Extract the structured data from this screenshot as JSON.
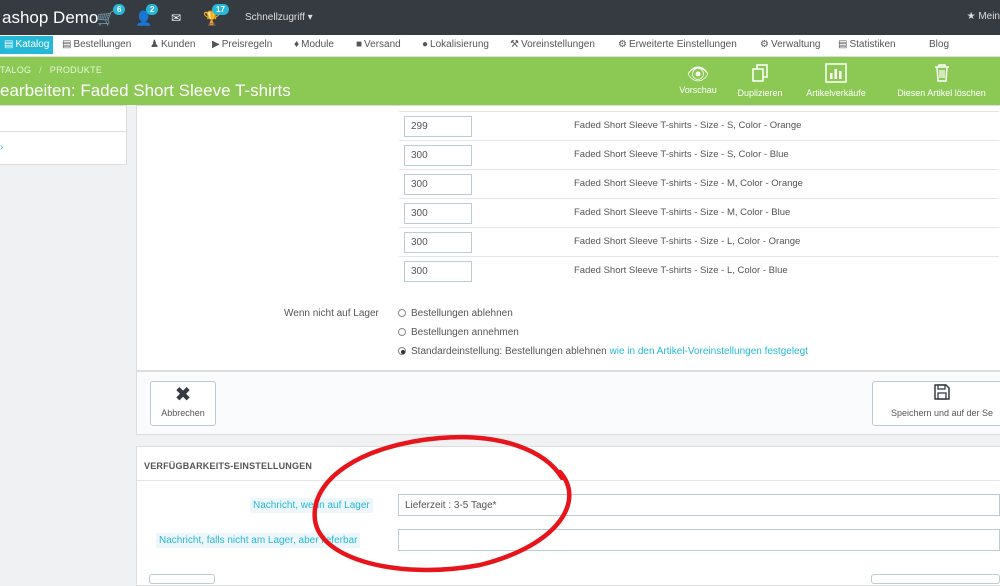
{
  "topbar": {
    "brand": "ashop Demo",
    "cart_badge": "6",
    "customers_badge": "2",
    "trophy_badge": "17",
    "quick_access": "Schnellzugriff ▾",
    "right_label": "★ Mein"
  },
  "nav": {
    "items": [
      {
        "label": "Katalog"
      },
      {
        "label": "Bestellungen"
      },
      {
        "label": "Kunden"
      },
      {
        "label": "Preisregeln"
      },
      {
        "label": "Module"
      },
      {
        "label": "Versand"
      },
      {
        "label": "Lokalisierung"
      },
      {
        "label": "Voreinstellungen"
      },
      {
        "label": "Erweiterte Einstellungen"
      },
      {
        "label": "Verwaltung"
      },
      {
        "label": "Statistiken"
      },
      {
        "label": "Blog"
      }
    ]
  },
  "header": {
    "breadcrumb_1": "TALOG",
    "breadcrumb_sep": "/",
    "breadcrumb_2": "PRODUKTE",
    "title": "earbeiten: Faded Short Sleeve T-shirts",
    "tools": [
      {
        "label": "Vorschau",
        "icon": "eye-icon"
      },
      {
        "label": "Duplizieren",
        "icon": "copy-icon"
      },
      {
        "label": "Artikelverkäufe",
        "icon": "bar-chart-icon"
      },
      {
        "label": "Diesen Artikel löschen",
        "icon": "trash-icon"
      }
    ]
  },
  "quantities": [
    {
      "qty": "299",
      "combination": "Faded Short Sleeve T-shirts - Size - S, Color - Orange"
    },
    {
      "qty": "300",
      "combination": "Faded Short Sleeve T-shirts - Size - S, Color - Blue"
    },
    {
      "qty": "300",
      "combination": "Faded Short Sleeve T-shirts - Size - M, Color - Orange"
    },
    {
      "qty": "300",
      "combination": "Faded Short Sleeve T-shirts - Size - M, Color - Blue"
    },
    {
      "qty": "300",
      "combination": "Faded Short Sleeve T-shirts - Size - L, Color - Orange"
    },
    {
      "qty": "300",
      "combination": "Faded Short Sleeve T-shirts - Size - L, Color - Blue"
    }
  ],
  "out_of_stock": {
    "label": "Wenn nicht auf Lager",
    "opt_deny": "Bestellungen ablehnen",
    "opt_allow": "Bestellungen annehmen",
    "opt_default": "Standardeinstellung: Bestellungen ablehnen",
    "opt_default_link": "wie in den Artikel-Voreinstellungen festgelegt"
  },
  "actions": {
    "cancel": "Abbrechen",
    "save": "Speichern und auf der Se"
  },
  "availability": {
    "heading": "VERFÜGBARKEITS-EINSTELLUNGEN",
    "in_stock_label": "Nachricht, wenn auf Lager",
    "in_stock_value": "Lieferzeit : 3-5 Tage*",
    "backorder_label": "Nachricht, falls nicht am Lager, aber lieferbar",
    "backorder_value": ""
  },
  "annotation_color": "#e8141b"
}
